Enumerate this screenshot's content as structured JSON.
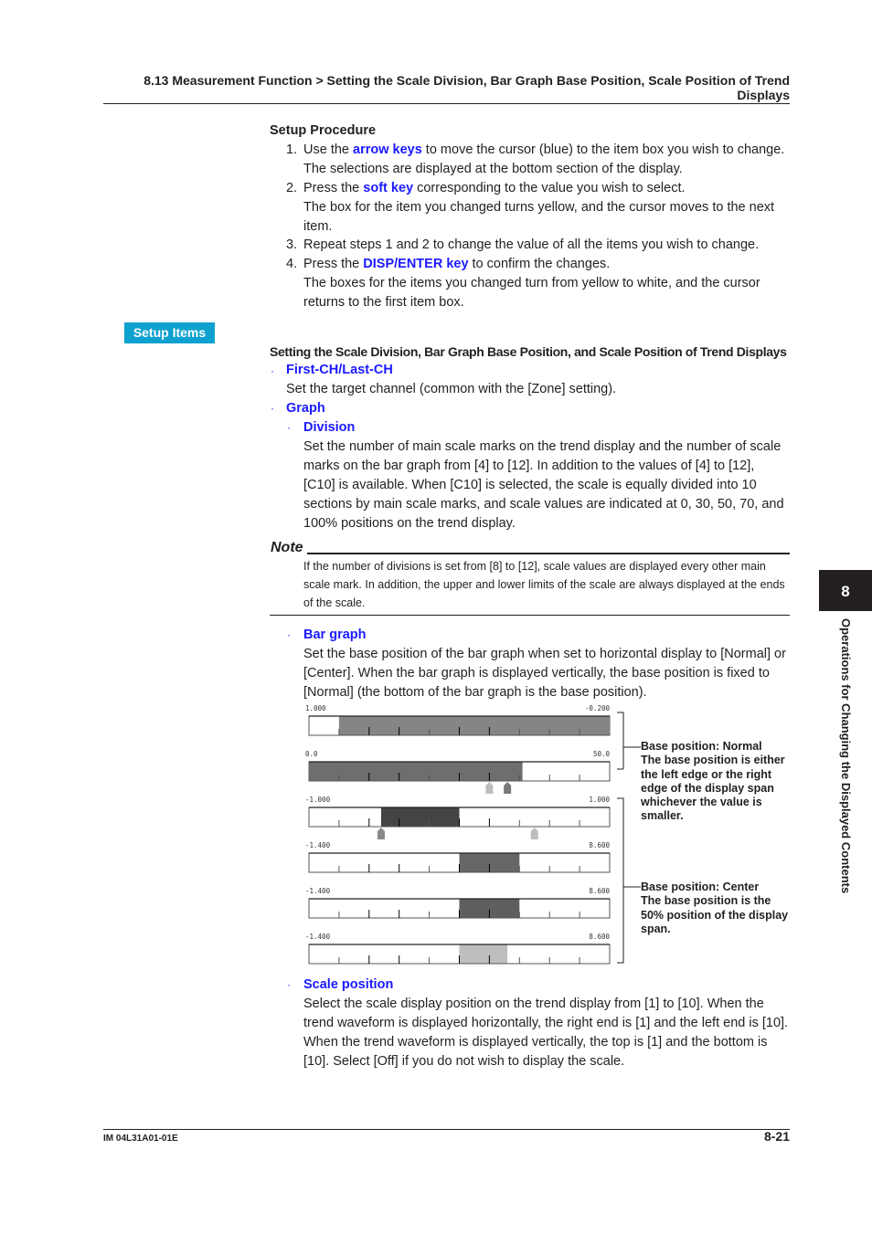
{
  "header": {
    "title_line1": "8.13  Measurement Function > Setting the Scale Division, Bar Graph Base Position, Scale Position of Trend",
    "title_line2": "Displays"
  },
  "setup_procedure": {
    "title": "Setup Procedure",
    "steps": [
      {
        "num": "1.",
        "pre": "Use the ",
        "key": "arrow keys",
        "post": " to move the cursor (blue) to the item box you wish to change.",
        "extra": "The selections are displayed at the bottom section of the display."
      },
      {
        "num": "2.",
        "pre": "Press the ",
        "key": "soft key",
        "post": " corresponding to the value you wish to select.",
        "extra": "The box for the item you changed turns yellow, and the cursor moves to the next item."
      },
      {
        "num": "3.",
        "pre": "Repeat steps 1 and 2 to change the value of all the items you wish to change.",
        "key": "",
        "post": "",
        "extra": ""
      },
      {
        "num": "4.",
        "pre": "Press the ",
        "key": "DISP/ENTER key",
        "post": " to confirm the changes.",
        "extra": "The boxes for the items you changed turn from yellow to white, and the cursor returns to the first item box."
      }
    ]
  },
  "setup_items": {
    "badge": "Setup Items",
    "section_title": "Setting the Scale Division, Bar Graph Base Position, and Scale Position of Trend Displays",
    "bullet": "·",
    "first_last": {
      "label": "First-CH/Last-CH",
      "desc": "Set the target channel (common with the [Zone] setting)."
    },
    "graph": {
      "label": "Graph"
    },
    "division": {
      "label": "Division",
      "desc": "Set the number of main scale marks on the trend display and the number of scale marks on the bar graph from [4] to [12].  In addition to the values of [4] to [12], [C10] is available.  When [C10] is selected, the scale is equally divided into 10 sections by main scale marks, and scale values are indicated at 0, 30, 50, 70, and 100% positions on the trend display."
    },
    "note": {
      "title": "Note",
      "text": "If the number of divisions is set from [8] to [12], scale values are displayed every other main scale mark.  In addition, the upper and lower limits of the scale are always displayed at the ends of the scale."
    },
    "bar_graph": {
      "label": "Bar graph",
      "desc": "Set the base position of the bar graph when set to horizontal display to [Normal] or [Center].  When the bar graph is displayed vertically, the base position is fixed to [Normal] (the bottom of the bar graph is the base position)."
    },
    "scale_position": {
      "label": "Scale position",
      "desc": "Select the scale display position on the trend display from [1] to [10].  When the trend waveform is displayed horizontally, the right end is [1] and the left end is [10].  When the trend waveform is displayed vertically, the top is [1] and the bottom is [10].  Select [Off] if you do not wish to display the scale."
    }
  },
  "figure": {
    "bars": [
      {
        "left_label": "1.000",
        "right_label": "-0.200",
        "fill_from": 0.1,
        "fill_to": 1.0,
        "color": "#858585"
      },
      {
        "left_label": "0.0",
        "right_label": "50.0",
        "fill_from": 0.0,
        "fill_to": 0.71,
        "color": "#6e6e6e",
        "markers": [
          {
            "pos": 0.6,
            "color": "#bdbdbd"
          },
          {
            "pos": 0.66,
            "color": "#7a7a7a"
          }
        ]
      },
      {
        "left_label": "-1.000",
        "right_label": "1.000",
        "fill_from": 0.24,
        "fill_to": 0.5,
        "color": "#444444",
        "markers": [
          {
            "pos": 0.24,
            "color": "#8a8a8a"
          },
          {
            "pos": 0.75,
            "color": "#bdbdbd"
          }
        ]
      },
      {
        "left_label": "-1.400",
        "right_label": "8.600",
        "fill_from": 0.5,
        "fill_to": 0.7,
        "color": "#666666"
      },
      {
        "left_label": "-1.400",
        "right_label": "8.600",
        "fill_from": 0.5,
        "fill_to": 0.7,
        "color": "#5e5e5e"
      },
      {
        "left_label": "-1.400",
        "right_label": "8.600",
        "fill_from": 0.5,
        "fill_to": 0.66,
        "color": "#bebebe"
      }
    ],
    "callout_normal": {
      "title": "Base position: Normal",
      "text": "The base position is either the left edge or the right edge of the display span whichever the value is smaller."
    },
    "callout_center": {
      "title": "Base position: Center",
      "text": "The base position is the 50% position of the display span."
    }
  },
  "side_tab": {
    "chapter": "8",
    "text": "Operations for Changing the Displayed Contents"
  },
  "footer": {
    "doc_id": "IM 04L31A01-01E",
    "page": "8-21"
  }
}
